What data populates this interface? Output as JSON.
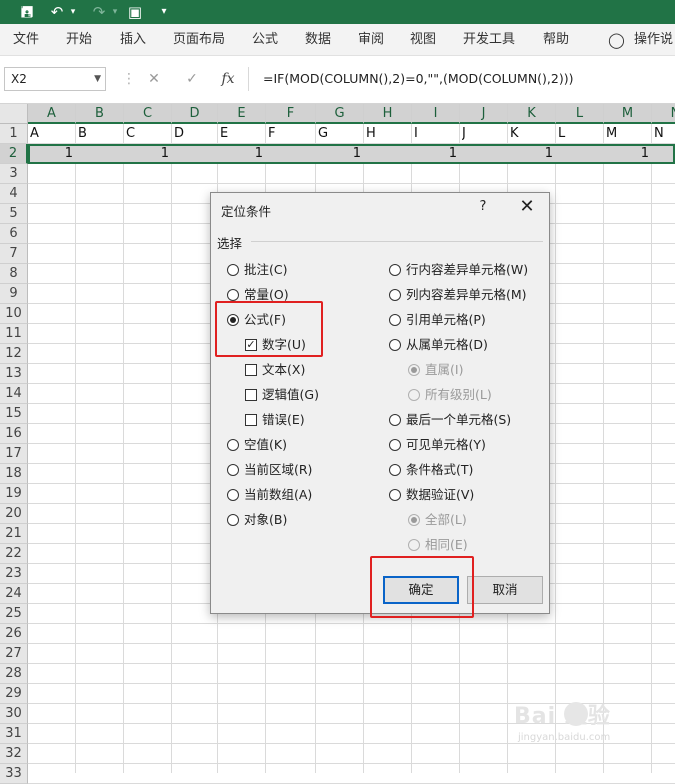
{
  "qat": {
    "save_icon": "save-icon",
    "undo_icon": "undo-icon",
    "redo_icon": "redo-icon",
    "camera_icon": "camera-icon",
    "customize_icon": "customize-icon"
  },
  "menu": {
    "items": [
      "文件",
      "开始",
      "插入",
      "页面布局",
      "公式",
      "数据",
      "审阅",
      "视图",
      "开发工具",
      "帮助"
    ],
    "tell_me": "操作说"
  },
  "formula_bar": {
    "name_box": "X2",
    "cancel_icon": "✕",
    "enter_icon": "✓",
    "fx_label": "fx",
    "formula": "=IF(MOD(COLUMN(),2)=0,\"\",(MOD(COLUMN(),2)))"
  },
  "sheet": {
    "columns": [
      "A",
      "B",
      "C",
      "D",
      "E",
      "F",
      "G",
      "H",
      "I",
      "J",
      "K",
      "L",
      "M",
      "N"
    ],
    "rows": [
      "1",
      "2",
      "3",
      "4",
      "5",
      "6",
      "7",
      "8",
      "9",
      "10",
      "11",
      "12",
      "13",
      "14",
      "15",
      "16",
      "17",
      "18",
      "19",
      "20",
      "21",
      "22",
      "23",
      "24",
      "25",
      "26",
      "27",
      "28",
      "29",
      "30",
      "31",
      "32",
      "33"
    ],
    "row1": [
      "A",
      "B",
      "C",
      "D",
      "E",
      "F",
      "G",
      "H",
      "I",
      "J",
      "K",
      "L",
      "M",
      "N"
    ],
    "row2": [
      "1",
      "",
      "1",
      "",
      "1",
      "",
      "1",
      "",
      "1",
      "",
      "1",
      "",
      "1",
      ""
    ]
  },
  "dialog": {
    "title": "定位条件",
    "help": "?",
    "close": "✕",
    "group_label": "选择",
    "left_options": [
      {
        "label": "批注(C)",
        "type": "radio",
        "checked": false
      },
      {
        "label": "常量(O)",
        "type": "radio",
        "checked": false
      },
      {
        "label": "公式(F)",
        "type": "radio",
        "checked": true
      },
      {
        "label": "数字(U)",
        "type": "check",
        "checked": true
      },
      {
        "label": "文本(X)",
        "type": "check",
        "checked": false
      },
      {
        "label": "逻辑值(G)",
        "type": "check",
        "checked": false
      },
      {
        "label": "错误(E)",
        "type": "check",
        "checked": false
      },
      {
        "label": "空值(K)",
        "type": "radio",
        "checked": false
      },
      {
        "label": "当前区域(R)",
        "type": "radio",
        "checked": false
      },
      {
        "label": "当前数组(A)",
        "type": "radio",
        "checked": false
      },
      {
        "label": "对象(B)",
        "type": "radio",
        "checked": false
      }
    ],
    "right_options": [
      {
        "label": "行内容差异单元格(W)",
        "type": "radio",
        "checked": false,
        "disabled": false
      },
      {
        "label": "列内容差异单元格(M)",
        "type": "radio",
        "checked": false,
        "disabled": false
      },
      {
        "label": "引用单元格(P)",
        "type": "radio",
        "checked": false,
        "disabled": false
      },
      {
        "label": "从属单元格(D)",
        "type": "radio",
        "checked": false,
        "disabled": false
      },
      {
        "label": "直属(I)",
        "type": "radio",
        "checked": true,
        "disabled": true
      },
      {
        "label": "所有级别(L)",
        "type": "radio",
        "checked": false,
        "disabled": true
      },
      {
        "label": "最后一个单元格(S)",
        "type": "radio",
        "checked": false,
        "disabled": false
      },
      {
        "label": "可见单元格(Y)",
        "type": "radio",
        "checked": false,
        "disabled": false
      },
      {
        "label": "条件格式(T)",
        "type": "radio",
        "checked": false,
        "disabled": false
      },
      {
        "label": "数据验证(V)",
        "type": "radio",
        "checked": false,
        "disabled": false
      },
      {
        "label": "全部(L)",
        "type": "radio",
        "checked": true,
        "disabled": true
      },
      {
        "label": "相同(E)",
        "type": "radio",
        "checked": false,
        "disabled": true
      }
    ],
    "ok_label": "确定",
    "cancel_label": "取消"
  },
  "watermark": {
    "brand": "Bai  经验",
    "url": "jingyan.baidu.com"
  },
  "colors": {
    "accent": "#217346",
    "highlight": "#e02020",
    "focus": "#0a64c8"
  }
}
